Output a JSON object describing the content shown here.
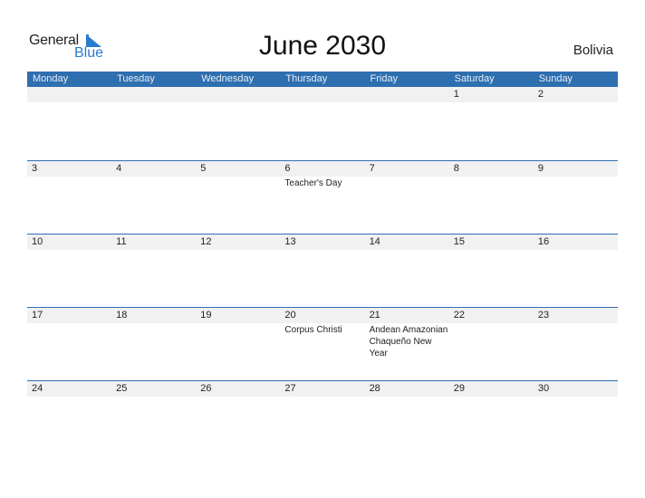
{
  "logo": {
    "general": "General",
    "blue": "Blue"
  },
  "title": "June 2030",
  "country": "Bolivia",
  "weekdays": [
    "Monday",
    "Tuesday",
    "Wednesday",
    "Thursday",
    "Friday",
    "Saturday",
    "Sunday"
  ],
  "weeks": [
    {
      "days": [
        {
          "num": "",
          "holiday": ""
        },
        {
          "num": "",
          "holiday": ""
        },
        {
          "num": "",
          "holiday": ""
        },
        {
          "num": "",
          "holiday": ""
        },
        {
          "num": "",
          "holiday": ""
        },
        {
          "num": "1",
          "holiday": ""
        },
        {
          "num": "2",
          "holiday": ""
        }
      ]
    },
    {
      "days": [
        {
          "num": "3",
          "holiday": ""
        },
        {
          "num": "4",
          "holiday": ""
        },
        {
          "num": "5",
          "holiday": ""
        },
        {
          "num": "6",
          "holiday": "Teacher's Day"
        },
        {
          "num": "7",
          "holiday": ""
        },
        {
          "num": "8",
          "holiday": ""
        },
        {
          "num": "9",
          "holiday": ""
        }
      ]
    },
    {
      "days": [
        {
          "num": "10",
          "holiday": ""
        },
        {
          "num": "11",
          "holiday": ""
        },
        {
          "num": "12",
          "holiday": ""
        },
        {
          "num": "13",
          "holiday": ""
        },
        {
          "num": "14",
          "holiday": ""
        },
        {
          "num": "15",
          "holiday": ""
        },
        {
          "num": "16",
          "holiday": ""
        }
      ]
    },
    {
      "days": [
        {
          "num": "17",
          "holiday": ""
        },
        {
          "num": "18",
          "holiday": ""
        },
        {
          "num": "19",
          "holiday": ""
        },
        {
          "num": "20",
          "holiday": "Corpus Christi"
        },
        {
          "num": "21",
          "holiday": "Andean Amazonian Chaqueño New Year"
        },
        {
          "num": "22",
          "holiday": ""
        },
        {
          "num": "23",
          "holiday": ""
        }
      ]
    },
    {
      "days": [
        {
          "num": "24",
          "holiday": ""
        },
        {
          "num": "25",
          "holiday": ""
        },
        {
          "num": "26",
          "holiday": ""
        },
        {
          "num": "27",
          "holiday": ""
        },
        {
          "num": "28",
          "holiday": ""
        },
        {
          "num": "29",
          "holiday": ""
        },
        {
          "num": "30",
          "holiday": ""
        }
      ]
    }
  ]
}
